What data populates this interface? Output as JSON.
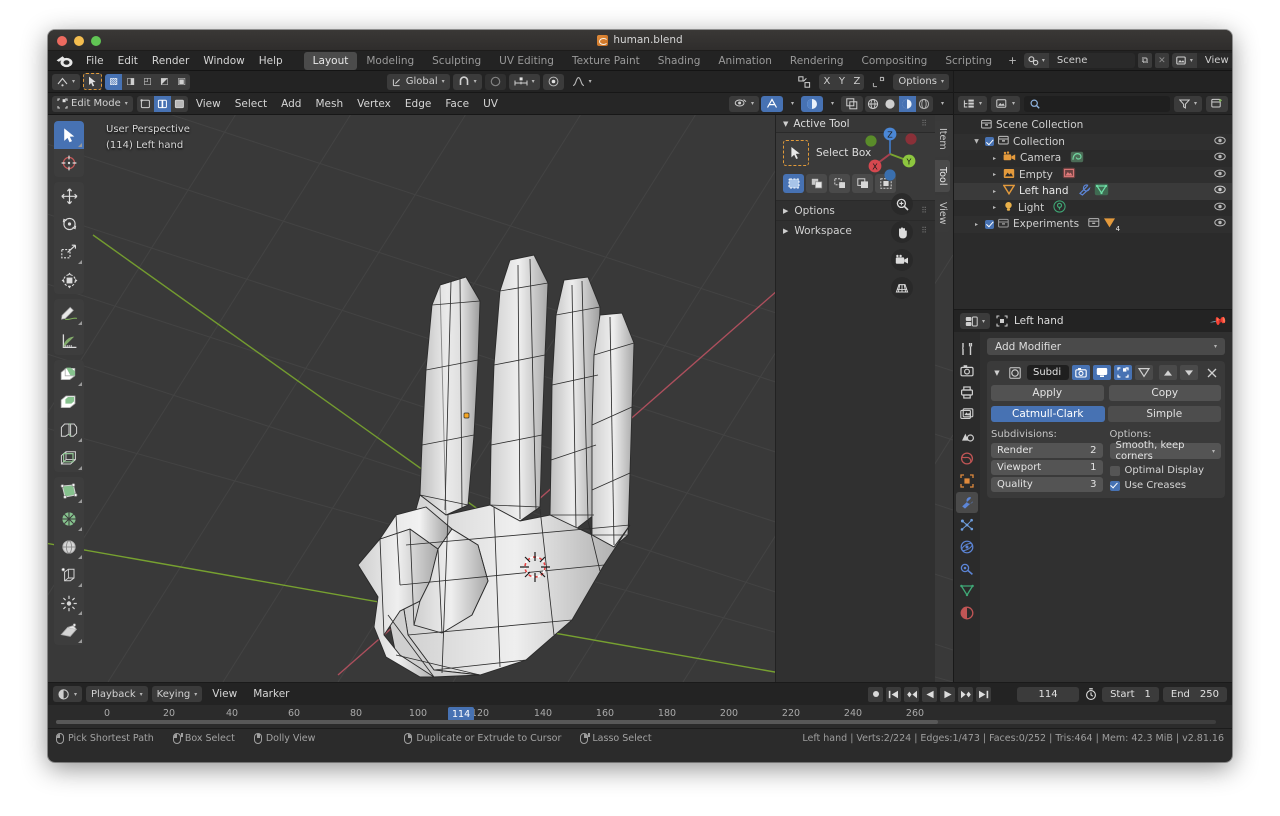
{
  "window": {
    "title": "human.blend",
    "file_icon": "blend-file-icon"
  },
  "topbar": {
    "logo": "blender-logo",
    "menus": [
      "File",
      "Edit",
      "Render",
      "Window",
      "Help"
    ],
    "workspaces": [
      {
        "label": "Layout",
        "active": true
      },
      {
        "label": "Modeling",
        "active": false
      },
      {
        "label": "Sculpting",
        "active": false
      },
      {
        "label": "UV Editing",
        "active": false
      },
      {
        "label": "Texture Paint",
        "active": false
      },
      {
        "label": "Shading",
        "active": false
      },
      {
        "label": "Animation",
        "active": false
      },
      {
        "label": "Rendering",
        "active": false
      },
      {
        "label": "Compositing",
        "active": false
      },
      {
        "label": "Scripting",
        "active": false
      },
      {
        "label": "+",
        "active": false
      }
    ],
    "scene_name": "Scene",
    "view_layer_name": "View Layer"
  },
  "viewport_header": {
    "mode": "Edit Mode",
    "menus": [
      "View",
      "Select",
      "Add",
      "Mesh",
      "Vertex",
      "Edge",
      "Face",
      "UV"
    ],
    "transform_orientation": "Global",
    "options_label": "Options",
    "axis_locks": [
      "X",
      "Y",
      "Z"
    ],
    "select_modes": [
      "vertex-select",
      "edge-select",
      "face-select"
    ],
    "select_mode_active_index": 1
  },
  "viewport": {
    "perspective_label": "User Perspective",
    "object_label": "(114) Left hand",
    "gizmo_axes": [
      "X",
      "Y",
      "Z"
    ],
    "nav_buttons": [
      "zoom-icon",
      "hand-icon",
      "camera-icon",
      "grid-icon"
    ],
    "colors": {
      "x_axis": "#c7576a",
      "y_axis": "#8cbb3f",
      "background": "#393939",
      "accent": "#4772b3"
    }
  },
  "toolbar": {
    "tools": [
      {
        "name": "tweak-select-box-tool",
        "active": true
      },
      {
        "name": "cursor-tool",
        "active": false
      },
      {
        "name": "move-tool",
        "active": false
      },
      {
        "name": "rotate-tool",
        "active": false
      },
      {
        "name": "scale-tool",
        "active": false
      },
      {
        "name": "transform-tool",
        "active": false
      },
      {
        "name": "annotate-tool",
        "active": false
      },
      {
        "name": "measure-tool",
        "active": false
      },
      {
        "name": "extrude-region-tool",
        "active": false
      },
      {
        "name": "inset-faces-tool",
        "active": false
      },
      {
        "name": "bevel-tool",
        "active": false
      },
      {
        "name": "loop-cut-tool",
        "active": false
      },
      {
        "name": "knife-tool",
        "active": false
      },
      {
        "name": "poly-build-tool",
        "active": false
      },
      {
        "name": "spin-tool",
        "active": false
      },
      {
        "name": "smooth-tool",
        "active": false
      },
      {
        "name": "shrink-fatten-tool",
        "active": false
      },
      {
        "name": "shear-tool",
        "active": false
      },
      {
        "name": "rip-region-tool",
        "active": false
      }
    ]
  },
  "npanel": {
    "title": "Active Tool",
    "tool_name": "Select Box",
    "mode_buttons": [
      "set-new-selection",
      "extend-selection",
      "subtract-selection",
      "invert-selection",
      "intersect-selection"
    ],
    "sections": [
      {
        "label": "Options",
        "expanded": false
      },
      {
        "label": "Workspace",
        "expanded": false
      }
    ],
    "tabs": [
      {
        "label": "Item",
        "active": false
      },
      {
        "label": "Tool",
        "active": true
      },
      {
        "label": "View",
        "active": false
      }
    ]
  },
  "outliner": {
    "search_placeholder": "",
    "root": "Scene Collection",
    "rows": [
      {
        "label": "Scene Collection",
        "indent": 0,
        "icon": "collection-icon",
        "disclosure": "",
        "checkbox": false,
        "badges": []
      },
      {
        "label": "Collection",
        "indent": 1,
        "icon": "collection-icon",
        "disclosure": "▼",
        "checkbox": true,
        "badges": []
      },
      {
        "label": "Camera",
        "indent": 2,
        "icon": "camera-icon",
        "disclosure": "▸",
        "checkbox": false,
        "badges": [
          "camera-data-icon"
        ]
      },
      {
        "label": "Empty",
        "indent": 2,
        "icon": "empty-image-icon",
        "disclosure": "▸",
        "checkbox": false,
        "badges": [
          "image-data-icon"
        ]
      },
      {
        "label": "Left hand",
        "indent": 2,
        "icon": "mesh-object-icon",
        "disclosure": "▸",
        "checkbox": false,
        "badges": [
          "modifier-icon",
          "mesh-data-icon"
        ],
        "selected": true
      },
      {
        "label": "Light",
        "indent": 2,
        "icon": "light-icon",
        "disclosure": "▸",
        "checkbox": false,
        "badges": [
          "light-data-icon"
        ]
      },
      {
        "label": "Experiments",
        "indent": 1,
        "icon": "collection-icon",
        "disclosure": "▸",
        "checkbox": true,
        "badges": [
          "collection-icon",
          "mesh-count-4"
        ]
      }
    ]
  },
  "properties": {
    "breadcrumb_object": "Left hand",
    "add_modifier_label": "Add Modifier",
    "modifier": {
      "name": "Subdi",
      "display_toggles": [
        "render-toggle",
        "realtime-toggle",
        "edit-mode-toggle",
        "on-cage-toggle"
      ],
      "display_toggles_on": [
        true,
        true,
        true,
        false
      ],
      "apply_label": "Apply",
      "copy_label": "Copy",
      "subdivision_type": [
        {
          "label": "Catmull-Clark",
          "active": true
        },
        {
          "label": "Simple",
          "active": false
        }
      ],
      "subdivisions_label": "Subdivisions:",
      "options_label": "Options:",
      "fields": [
        {
          "label": "Render",
          "value": "2"
        },
        {
          "label": "Viewport",
          "value": "1"
        },
        {
          "label": "Quality",
          "value": "3"
        }
      ],
      "uv_smooth": "Smooth, keep corners",
      "checkboxes": [
        {
          "label": "Optimal Display",
          "checked": false
        },
        {
          "label": "Use Creases",
          "checked": true
        }
      ]
    },
    "tabs": [
      {
        "name": "tool-tab",
        "active": false
      },
      {
        "name": "render-tab",
        "active": false
      },
      {
        "name": "output-tab",
        "active": false
      },
      {
        "name": "view-layer-tab",
        "active": false
      },
      {
        "name": "scene-tab",
        "active": false
      },
      {
        "name": "world-tab",
        "active": false
      },
      {
        "name": "object-tab",
        "active": false
      },
      {
        "name": "modifier-tab",
        "active": true
      },
      {
        "name": "particles-tab",
        "active": false
      },
      {
        "name": "physics-tab",
        "active": false
      },
      {
        "name": "constraints-tab",
        "active": false
      },
      {
        "name": "object-data-tab",
        "active": false
      },
      {
        "name": "material-tab",
        "active": false
      }
    ]
  },
  "timeline": {
    "menus": [
      "Playback",
      "Keying",
      "View",
      "Marker"
    ],
    "current_frame": "114",
    "start_label": "Start",
    "start_value": "1",
    "end_label": "End",
    "end_value": "250",
    "ticks": [
      "0",
      "20",
      "40",
      "60",
      "80",
      "100",
      "120",
      "140",
      "160",
      "180",
      "200",
      "220",
      "240",
      "260"
    ],
    "playhead_frame": "114"
  },
  "statusbar": {
    "hints": [
      {
        "mouse": "left",
        "label": "Pick Shortest Path"
      },
      {
        "mouse": "left-drag",
        "label": "Box Select"
      },
      {
        "mouse": "middle",
        "label": "Dolly View"
      },
      {
        "mouse": "right",
        "label": "Duplicate or Extrude to Cursor"
      },
      {
        "mouse": "right-drag",
        "label": "Lasso Select"
      }
    ],
    "stats": "Left hand | Verts:2/224 | Edges:1/473 | Faces:0/252 | Tris:464 | Mem: 42.3 MiB | v2.81.16"
  }
}
